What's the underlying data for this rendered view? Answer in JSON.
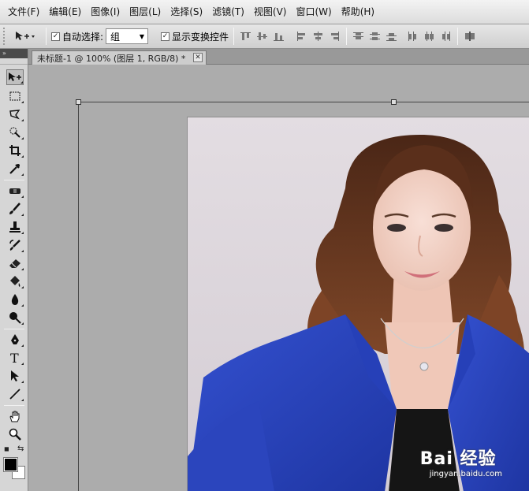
{
  "menu": [
    "文件(F)",
    "编辑(E)",
    "图像(I)",
    "图层(L)",
    "选择(S)",
    "滤镜(T)",
    "视图(V)",
    "窗口(W)",
    "帮助(H)"
  ],
  "options": {
    "tool_preset_icon": "move-arrow-icon",
    "auto_select_label": "自动选择:",
    "auto_select_checked": true,
    "auto_select_value": "组",
    "show_transform_label": "显示变换控件",
    "show_transform_checked": true
  },
  "document": {
    "tab_title": "未标题-1 @ 100% (图层 1, RGB/8) *"
  },
  "watermark": {
    "brand": "Bai  经验",
    "url": "jingyan.baidu.com"
  },
  "colors": {
    "foreground": "#000000",
    "background": "#ffffff",
    "jacket": "#2a43b8",
    "hair": "#6b3a22"
  }
}
